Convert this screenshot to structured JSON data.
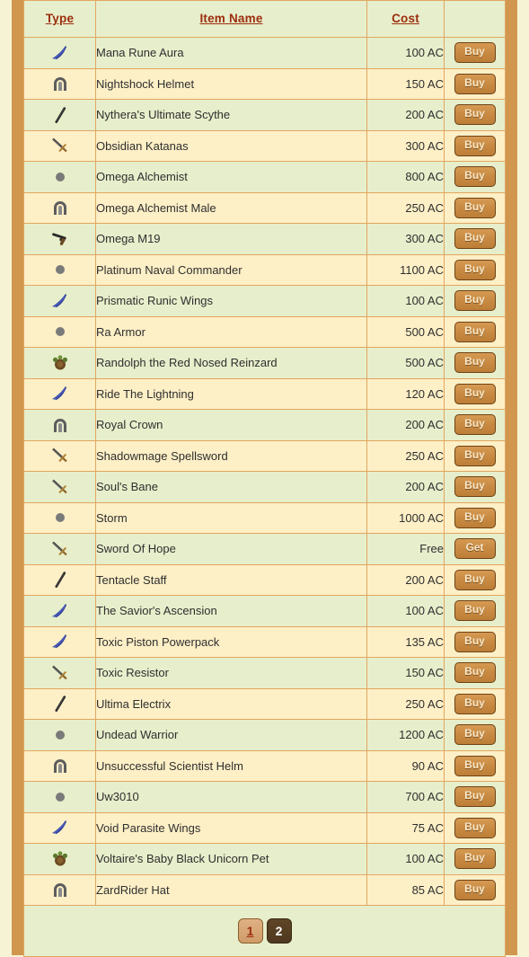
{
  "theme": {
    "frame_color": "#d1974f",
    "page_background": "#f6f3d5",
    "row_even_color": "#e7eecb",
    "row_odd_color": "#fdefc6",
    "header_link_color": "#9b2d0d",
    "button_color": "#c88a42"
  },
  "table": {
    "headers": [
      {
        "label": "Type",
        "key": "type"
      },
      {
        "label": "Item Name",
        "key": "name"
      },
      {
        "label": "Cost",
        "key": "cost"
      },
      {
        "label": "",
        "key": "action"
      }
    ],
    "rows": [
      {
        "icon": "wings-icon",
        "name": "Mana Rune Aura",
        "cost": "100 AC",
        "action": "Buy"
      },
      {
        "icon": "helmet-icon",
        "name": "Nightshock Helmet",
        "cost": "150 AC",
        "action": "Buy"
      },
      {
        "icon": "staff-icon",
        "name": "Nythera's Ultimate Scythe",
        "cost": "200 AC",
        "action": "Buy"
      },
      {
        "icon": "sword-icon",
        "name": "Obsidian Katanas",
        "cost": "300 AC",
        "action": "Buy"
      },
      {
        "icon": "armor-icon",
        "name": "Omega Alchemist",
        "cost": "800 AC",
        "action": "Buy"
      },
      {
        "icon": "helmet-icon",
        "name": "Omega Alchemist Male",
        "cost": "250 AC",
        "action": "Buy"
      },
      {
        "icon": "gun-icon",
        "name": "Omega M19",
        "cost": "300 AC",
        "action": "Buy"
      },
      {
        "icon": "armor-icon",
        "name": "Platinum Naval Commander",
        "cost": "1100 AC",
        "action": "Buy"
      },
      {
        "icon": "wings-icon",
        "name": "Prismatic Runic Wings",
        "cost": "100 AC",
        "action": "Buy"
      },
      {
        "icon": "armor-icon",
        "name": "Ra Armor",
        "cost": "500 AC",
        "action": "Buy"
      },
      {
        "icon": "pet-icon",
        "name": "Randolph the Red Nosed Reinzard",
        "cost": "500 AC",
        "action": "Buy"
      },
      {
        "icon": "wings-icon",
        "name": "Ride The Lightning",
        "cost": "120 AC",
        "action": "Buy"
      },
      {
        "icon": "helmet-icon",
        "name": "Royal Crown",
        "cost": "200 AC",
        "action": "Buy"
      },
      {
        "icon": "sword-icon",
        "name": "Shadowmage Spellsword",
        "cost": "250 AC",
        "action": "Buy"
      },
      {
        "icon": "sword-icon",
        "name": "Soul's Bane",
        "cost": "200 AC",
        "action": "Buy"
      },
      {
        "icon": "armor-icon",
        "name": "Storm",
        "cost": "1000 AC",
        "action": "Buy"
      },
      {
        "icon": "sword-icon",
        "name": "Sword Of Hope",
        "cost": "Free",
        "action": "Get"
      },
      {
        "icon": "staff-icon",
        "name": "Tentacle Staff",
        "cost": "200 AC",
        "action": "Buy"
      },
      {
        "icon": "wings-icon",
        "name": "The Savior's Ascension",
        "cost": "100 AC",
        "action": "Buy"
      },
      {
        "icon": "wings-icon",
        "name": "Toxic Piston Powerpack",
        "cost": "135 AC",
        "action": "Buy"
      },
      {
        "icon": "sword-icon",
        "name": "Toxic Resistor",
        "cost": "150 AC",
        "action": "Buy"
      },
      {
        "icon": "staff-icon",
        "name": "Ultima Electrix",
        "cost": "250 AC",
        "action": "Buy"
      },
      {
        "icon": "armor-icon",
        "name": "Undead Warrior",
        "cost": "1200 AC",
        "action": "Buy"
      },
      {
        "icon": "helmet-icon",
        "name": "Unsuccessful Scientist Helm",
        "cost": "90 AC",
        "action": "Buy"
      },
      {
        "icon": "armor-icon",
        "name": "Uw3010",
        "cost": "700 AC",
        "action": "Buy"
      },
      {
        "icon": "wings-icon",
        "name": "Void Parasite Wings",
        "cost": "75 AC",
        "action": "Buy"
      },
      {
        "icon": "pet-icon",
        "name": "Voltaire's Baby Black Unicorn Pet",
        "cost": "100 AC",
        "action": "Buy"
      },
      {
        "icon": "helmet-icon",
        "name": "ZardRider Hat",
        "cost": "85 AC",
        "action": "Buy"
      }
    ]
  },
  "pagination": {
    "pages": [
      {
        "label": "1",
        "current": false
      },
      {
        "label": "2",
        "current": true
      }
    ]
  }
}
